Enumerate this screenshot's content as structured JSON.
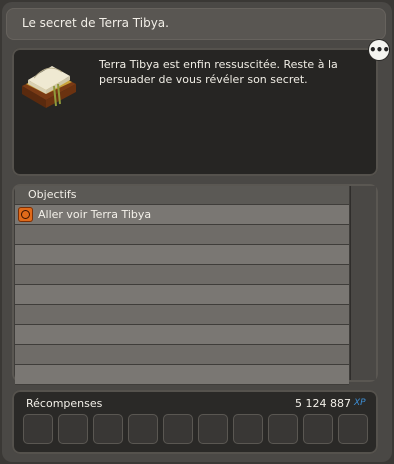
{
  "quest": {
    "title": "Le secret de Terra Tibya.",
    "description": "Terra Tibya est enfin ressuscitée. Reste à la persuader de vous révéler son secret.",
    "more_label": "•••"
  },
  "objectives": {
    "header": "Objectifs",
    "items": [
      {
        "label": "Aller voir Terra Tibya",
        "icon": "target-icon"
      }
    ]
  },
  "rewards": {
    "label": "Récompenses",
    "xp": "5 124 887",
    "xp_unit": "XP",
    "slot_count": 10
  },
  "colors": {
    "panel": "#4a4845",
    "row_light": "#7a7773",
    "row_dark": "#6f6c68",
    "objective_icon": "#e06a1a",
    "xp_blue": "#3d8fd6"
  }
}
